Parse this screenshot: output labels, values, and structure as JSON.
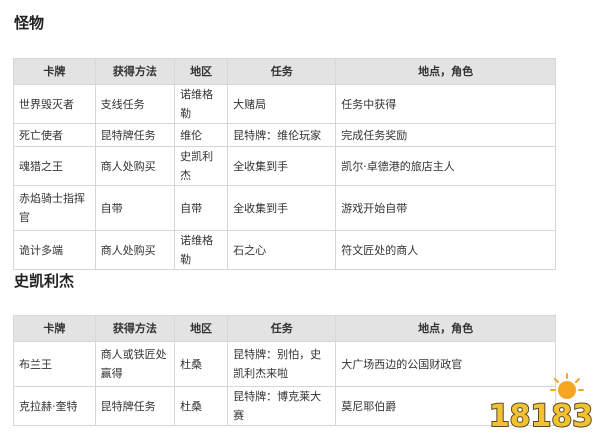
{
  "sections": [
    {
      "title": "怪物",
      "headers": [
        "卡牌",
        "获得方法",
        "地区",
        "任务",
        "地点，角色"
      ],
      "rows": [
        [
          "世界毁灭者",
          "支线任务",
          "诺维格勒",
          "大赌局",
          "任务中获得"
        ],
        [
          "死亡使者",
          "昆特牌任务",
          "维伦",
          "昆特牌：维伦玩家",
          "完成任务奖励"
        ],
        [
          "魂猎之王",
          "商人处购买",
          "史凯利杰",
          "全收集到手",
          "凯尔·卓德港的旅店主人"
        ],
        [
          "赤焰骑士指挥官",
          "自带",
          "自带",
          "全收集到手",
          "游戏开始自带"
        ],
        [
          "诡计多端",
          "商人处购买",
          "诺维格勒",
          "石之心",
          "符文匠处的商人"
        ]
      ]
    },
    {
      "title": "史凯利杰",
      "headers": [
        "卡牌",
        "获得方法",
        "地区",
        "任务",
        "地点，角色"
      ],
      "rows": [
        [
          "布兰王",
          "商人或铁匠处赢得",
          "杜桑",
          "昆特牌：别怕，史凯利杰来啦",
          "大广场西边的公国财政官"
        ],
        [
          "克拉赫·奎特",
          "昆特牌任务",
          "杜桑",
          "昆特牌：博克莱大赛",
          "莫尼耶伯爵"
        ]
      ]
    }
  ],
  "watermark": "18183"
}
